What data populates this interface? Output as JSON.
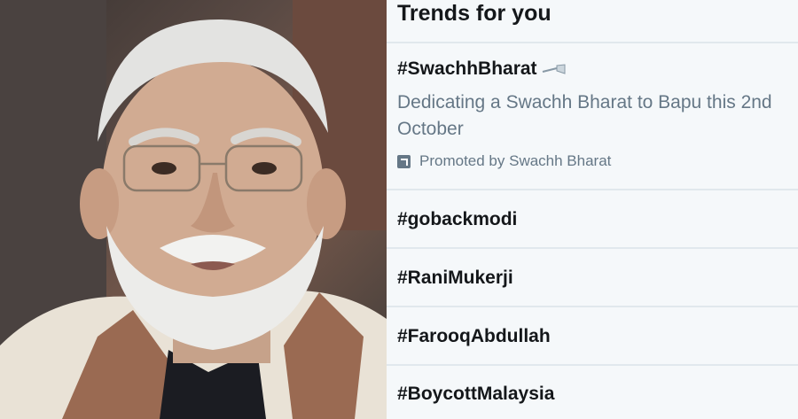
{
  "panel": {
    "title": "Trends for you",
    "promoted_trend": {
      "tag": "#SwachhBharat",
      "emoji": "broom-emoji",
      "description": "Dedicating a Swachh Bharat to Bapu this 2nd October",
      "promoted_label": "Promoted by Swachh Bharat",
      "promoted_icon": "promoted-arrow-icon"
    },
    "trends": [
      {
        "tag": "#gobackmodi"
      },
      {
        "tag": "#RaniMukerji"
      },
      {
        "tag": "#FarooqAbdullah"
      },
      {
        "tag": "#BoycottMalaysia"
      }
    ]
  },
  "colors": {
    "panel_bg": "#f5f8fa",
    "text_primary": "#14171a",
    "text_secondary": "#657786",
    "divider": "#e1e8ed"
  }
}
